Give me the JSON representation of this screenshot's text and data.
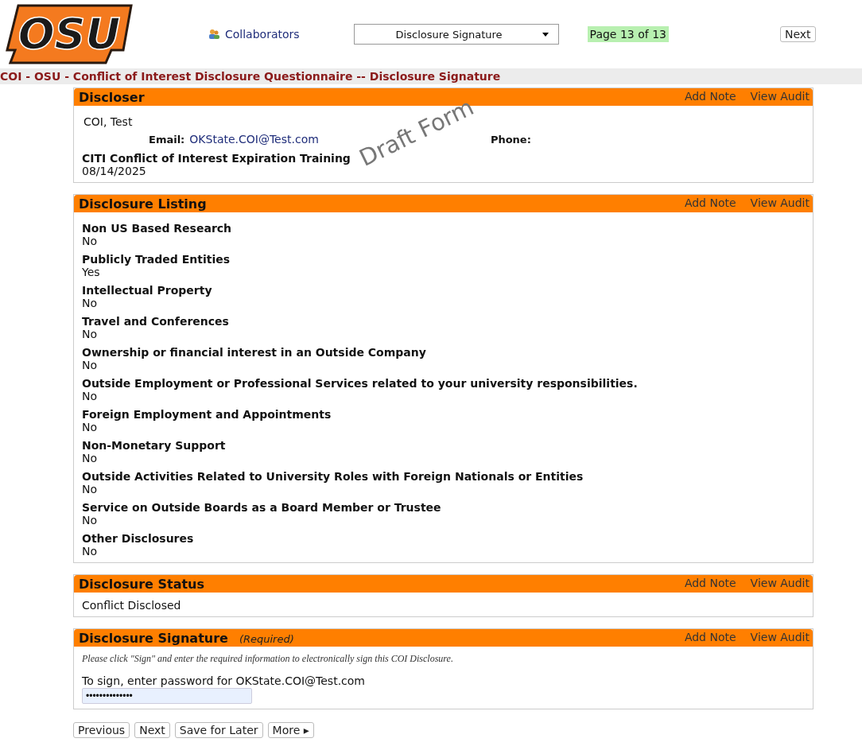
{
  "header": {
    "logo_text": "OSU",
    "collaborators": "Collaborators",
    "page_select": "Disclosure Signature",
    "page_indicator": "Page 13 of 13",
    "next": "Next"
  },
  "title": "COI - OSU - Conflict of Interest Disclosure Questionnaire -- Disclosure Signature",
  "watermark": "Draft Form",
  "discloser": {
    "title": "Discloser",
    "add_note": "Add Note",
    "view_audit": "View Audit",
    "name": "COI, Test",
    "email_label": "Email:",
    "email": "OKState.COI@Test.com",
    "phone_label": "Phone:",
    "training_label": "CITI Conflict of Interest Expiration Training",
    "training_date": "08/14/2025"
  },
  "listing": {
    "title": "Disclosure Listing",
    "add_note": "Add Note",
    "view_audit": "View Audit",
    "items": [
      {
        "label": "Non US Based Research",
        "value": "No"
      },
      {
        "label": "Publicly Traded Entities",
        "value": "Yes"
      },
      {
        "label": "Intellectual Property",
        "value": "No"
      },
      {
        "label": "Travel and Conferences",
        "value": "No"
      },
      {
        "label": "Ownership or financial interest in an Outside Company",
        "value": "No"
      },
      {
        "label": "Outside Employment or Professional Services related to your university responsibilities.",
        "value": "No"
      },
      {
        "label": "Foreign Employment and Appointments",
        "value": "No"
      },
      {
        "label": "Non-Monetary Support",
        "value": "No"
      },
      {
        "label": "Outside Activities Related to University Roles with Foreign Nationals or Entities",
        "value": "No"
      },
      {
        "label": "Service on Outside Boards as a Board Member or Trustee",
        "value": "No"
      },
      {
        "label": "Other Disclosures",
        "value": "No"
      }
    ]
  },
  "status": {
    "title": "Disclosure Status",
    "add_note": "Add Note",
    "view_audit": "View Audit",
    "value": "Conflict Disclosed"
  },
  "signature": {
    "title": "Disclosure Signature",
    "required": "(Required)",
    "add_note": "Add Note",
    "view_audit": "View Audit",
    "instructions": "Please click \"Sign\" and enter the required information to electronically sign this COI Disclosure.",
    "prompt": "To sign, enter password for OKState.COI@Test.com",
    "password": "••••••••••••••"
  },
  "footer_buttons": [
    "Previous",
    "Next",
    "Save for Later",
    "More ▸"
  ]
}
